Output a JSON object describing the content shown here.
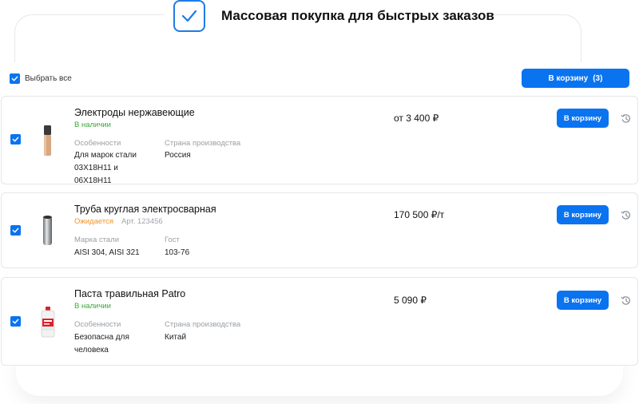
{
  "header": {
    "title": "Массовая покупка для быстрых заказов"
  },
  "toolbar": {
    "select_all_label": "Выбрать все",
    "cart_label": "В корзину",
    "cart_count": "(3)"
  },
  "colors": {
    "accent": "#0a73f0",
    "in_stock": "#3aa935",
    "pending": "#f0952a"
  },
  "products": [
    {
      "name": "Электроды нержавеющие",
      "status": "В наличии",
      "article": "",
      "attr1_label": "Особенности",
      "attr1_value": "Для марок стали 03Х18Н11 и 06Х18Н11",
      "attr2_label": "Страна производства",
      "attr2_value": "Россия",
      "price": "от 3 400 ₽",
      "button": "В корзину",
      "icon": "history-icon"
    },
    {
      "name": "Труба круглая электросварная",
      "status": "Ожидается",
      "article": "Арт. 123456",
      "attr1_label": "Марка стали",
      "attr1_value": "AISI 304, AISI 321",
      "attr2_label": "Гост",
      "attr2_value": "103-76",
      "price": "170 500 ₽/т",
      "button": "В корзину",
      "icon": "history-icon"
    },
    {
      "name": "Паста травильная Patro",
      "status": "В наличии",
      "article": "",
      "attr1_label": "Особенности",
      "attr1_value": "Безопасна для человека",
      "attr2_label": "Страна производства",
      "attr2_value": "Китай",
      "price": "5 090 ₽",
      "button": "В корзину",
      "icon": "history-icon"
    }
  ]
}
